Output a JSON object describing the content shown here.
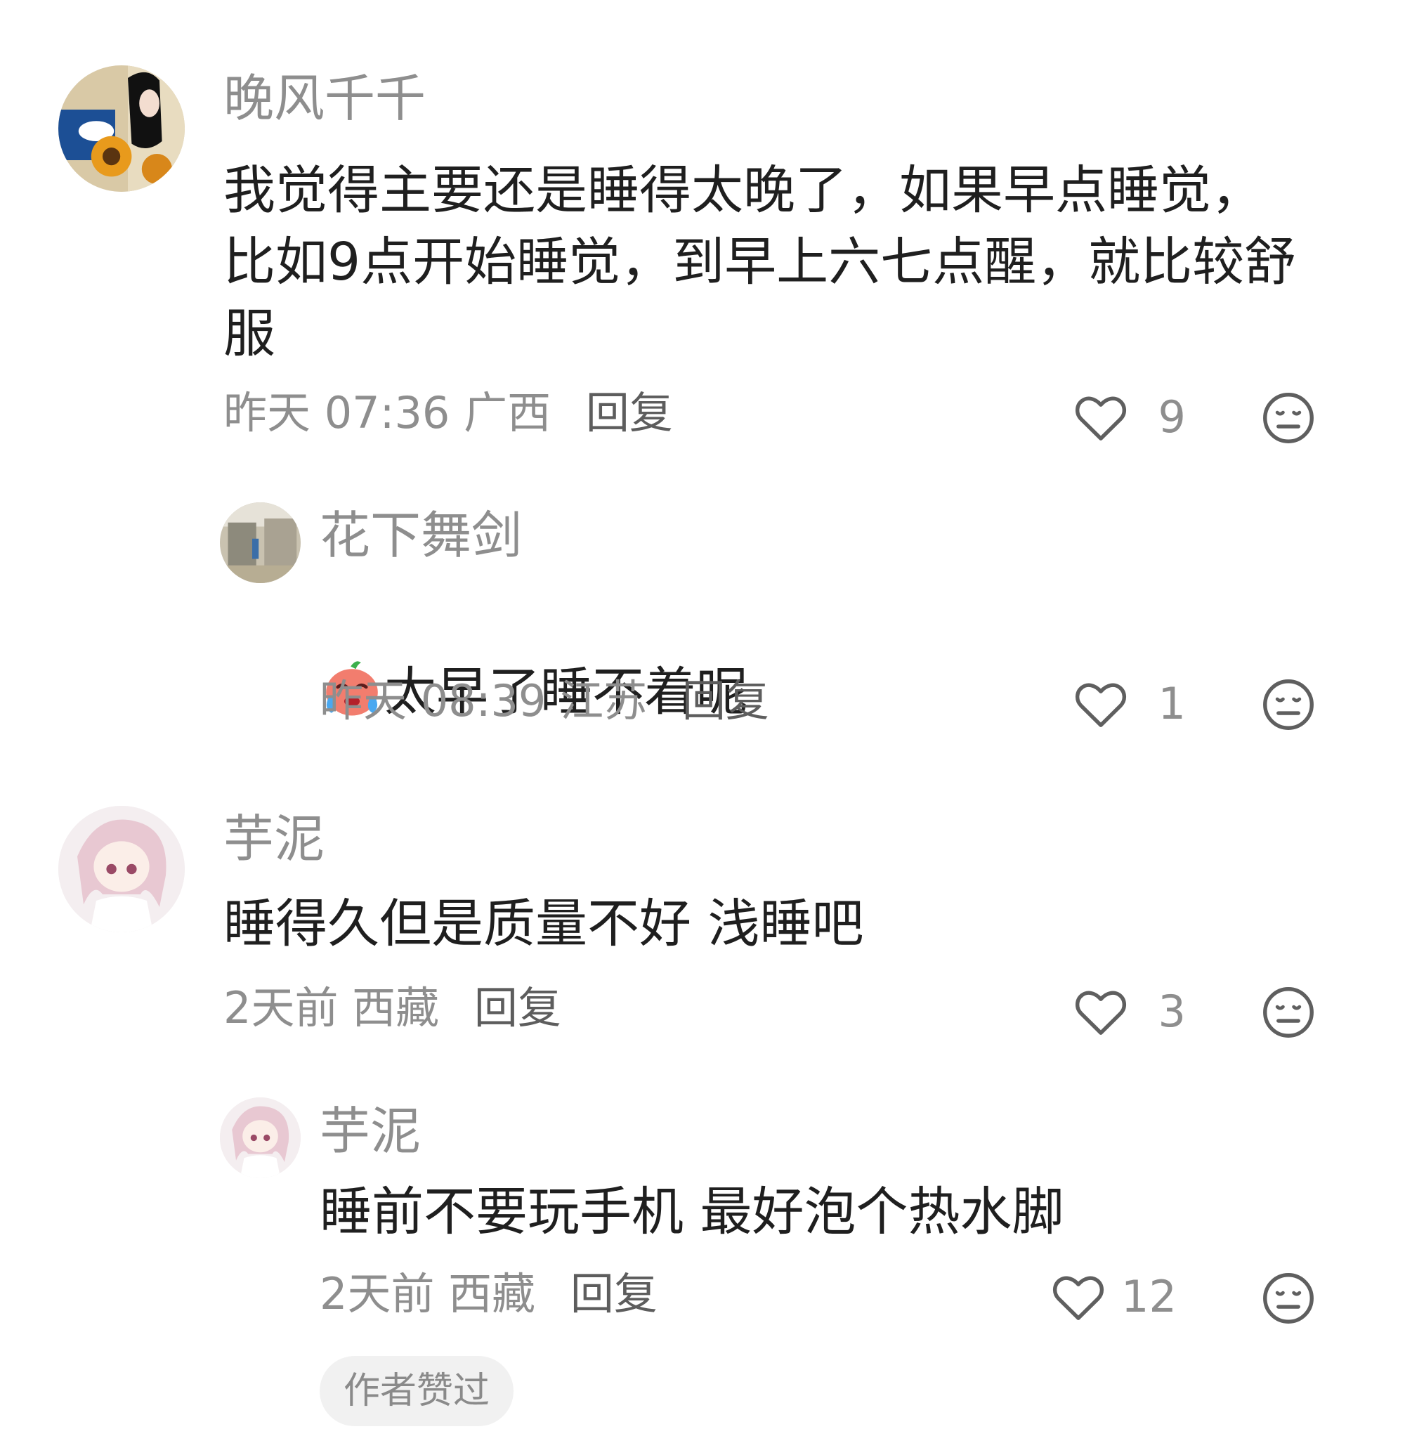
{
  "comments": [
    {
      "username": "晚风千千",
      "text": "我觉得主要还是睡得太晚了，如果早点睡觉，\n比如9点开始睡觉，到早上六七点醒，就比较舒\n服",
      "time": "昨天 07:36",
      "location": "广西",
      "reply_label": "回复",
      "likes": "9"
    },
    {
      "username": "花下舞剑",
      "text": "太早了睡不着呢",
      "emoji": "crying-face-emoji",
      "time": "昨天 08:39",
      "location": "江苏",
      "reply_label": "回复",
      "likes": "1"
    },
    {
      "username": "芋泥",
      "text": "睡得久但是质量不好 浅睡吧",
      "time": "2天前",
      "location": "西藏",
      "reply_label": "回复",
      "likes": "3"
    },
    {
      "username": "芋泥",
      "text": "睡前不要玩手机 最好泡个热水脚",
      "time": "2天前",
      "location": "西藏",
      "reply_label": "回复",
      "likes": "12",
      "badge": "作者赞过"
    }
  ],
  "icons": {
    "like": "heart-outline-icon",
    "dislike": "neutral-face-icon"
  },
  "colors": {
    "secondary_text": "#8e8e8e",
    "primary_text": "#1f1f1f",
    "badge_bg": "#f1f1f1"
  }
}
